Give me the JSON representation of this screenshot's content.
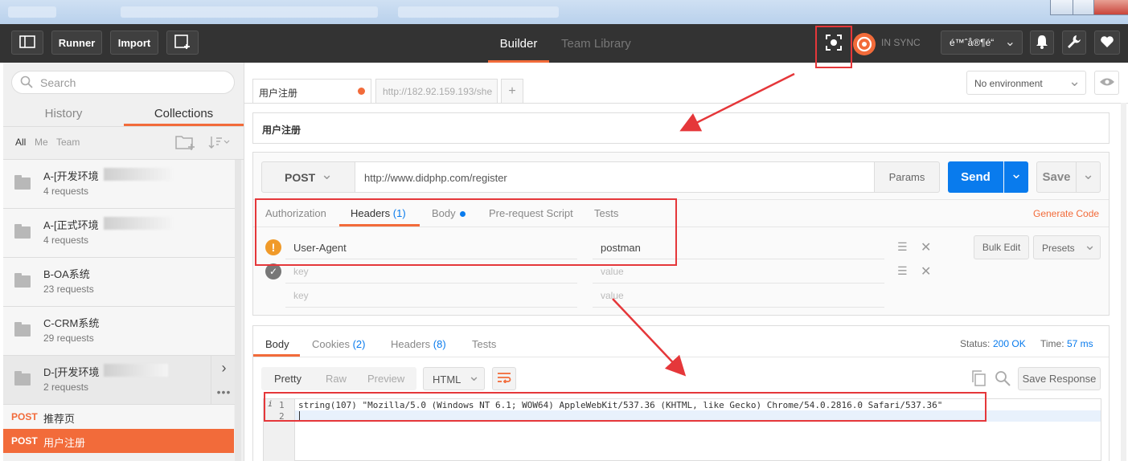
{
  "header": {
    "runner": "Runner",
    "import": "Import",
    "tab_builder": "Builder",
    "tab_team_library": "Team Library",
    "sync_status": "IN SYNC",
    "user_menu": "é™ˆå®¶é“",
    "icons": [
      "sidebar-toggle-icon",
      "new-tab-icon",
      "interceptor-icon",
      "sync-icon",
      "bell-icon",
      "wrench-icon",
      "heart-icon"
    ]
  },
  "sidebar": {
    "search_placeholder": "Search",
    "tabs": [
      "History",
      "Collections"
    ],
    "filters": [
      "All",
      "Me",
      "Team"
    ],
    "collections": [
      {
        "name": "A-[开发环境",
        "count": "4 requests"
      },
      {
        "name": "A-[正式环境",
        "count": "4 requests"
      },
      {
        "name": "B-OA系统",
        "count": "23 requests"
      },
      {
        "name": "C-CRM系统",
        "count": "29 requests"
      },
      {
        "name": "D-[开发环境",
        "count": "2 requests"
      }
    ],
    "requests": [
      {
        "method": "POST",
        "name": "推荐页"
      },
      {
        "method": "POST",
        "name": "用户注册"
      }
    ]
  },
  "request_tabs": {
    "active": "用户注册",
    "second": "http://182.92.159.193/she",
    "add": "+"
  },
  "environment": {
    "selected": "No environment"
  },
  "request": {
    "name": "用户注册",
    "method": "POST",
    "url": "http://www.didphp.com/register",
    "params_label": "Params",
    "send_label": "Send",
    "save_label": "Save",
    "generate_code": "Generate Code",
    "tabs": {
      "authorization": "Authorization",
      "headers": "Headers",
      "headers_count": "(1)",
      "body": "Body",
      "pre_request": "Pre-request Script",
      "tests": "Tests"
    },
    "headers": [
      {
        "key": "User-Agent",
        "value": "postman"
      }
    ],
    "key_placeholder": "key",
    "value_placeholder": "value",
    "bulk_edit": "Bulk Edit",
    "presets": "Presets"
  },
  "response": {
    "tabs": {
      "body": "Body",
      "cookies": "Cookies",
      "cookies_count": "(2)",
      "headers": "Headers",
      "headers_count": "(8)",
      "tests": "Tests"
    },
    "status_label": "Status:",
    "status_value": "200 OK",
    "time_label": "Time:",
    "time_value": "57 ms",
    "view_modes": [
      "Pretty",
      "Raw",
      "Preview"
    ],
    "format": "HTML",
    "save_response": "Save Response",
    "lines": [
      {
        "num": "1",
        "text": "string(107) \"Mozilla/5.0 (Windows NT 6.1; WOW64) AppleWebKit/537.36 (KHTML, like Gecko) Chrome/54.0.2816.0 Safari/537.36\""
      },
      {
        "num": "2",
        "text": ""
      }
    ]
  },
  "colors": {
    "accent": "#f26b3a",
    "send_blue": "#097bed",
    "header_bg": "#333333",
    "annotation_red": "#e5373a"
  }
}
